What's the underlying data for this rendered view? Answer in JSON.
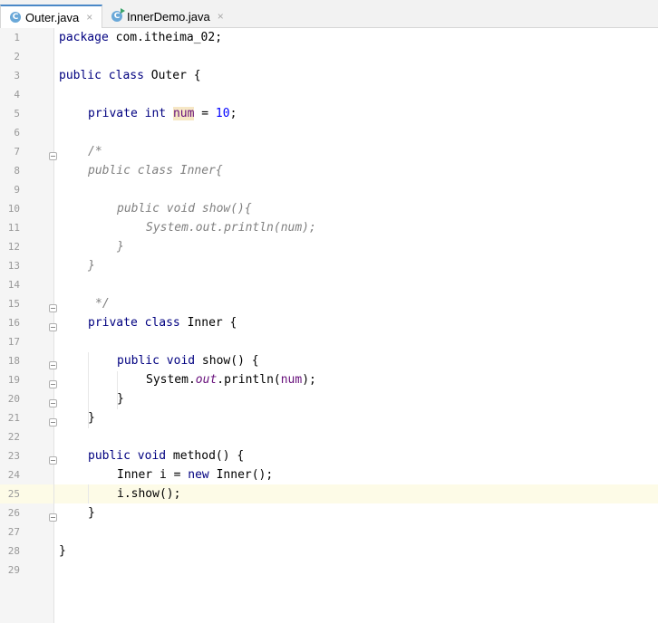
{
  "tabs": [
    {
      "label": "Outer.java",
      "icon": "class-icon",
      "active": true
    },
    {
      "label": "InnerDemo.java",
      "icon": "runnable-class-icon",
      "active": false
    }
  ],
  "close_glyph": "×",
  "class_glyph": "C",
  "line_numbers": [
    "1",
    "2",
    "3",
    "4",
    "5",
    "6",
    "7",
    "8",
    "9",
    "10",
    "11",
    "12",
    "13",
    "14",
    "15",
    "16",
    "17",
    "18",
    "19",
    "20",
    "21",
    "22",
    "23",
    "24",
    "25",
    "26",
    "27",
    "28",
    "29"
  ],
  "code": {
    "l1": {
      "kw": "package",
      "rest": " com.itheima_02;"
    },
    "l3": {
      "kw1": "public",
      "kw2": "class",
      "rest": " Outer {"
    },
    "l5": {
      "kw1": "private",
      "kw2": "int",
      "field": "num",
      "eq": " = ",
      "num": "10",
      "semi": ";"
    },
    "l7": "/*",
    "l8": "public class Inner{",
    "l10": "public void show(){",
    "l11": "System.out.println(num);",
    "l12": "}",
    "l13": "}",
    "l15": "*/",
    "l16": {
      "kw1": "private",
      "kw2": "class",
      "rest": " Inner {"
    },
    "l18": {
      "kw1": "public",
      "kw2": "void",
      "rest": " show() {"
    },
    "l19": {
      "a": "System.",
      "b": "out",
      "c": ".println(",
      "d": "num",
      "e": ");"
    },
    "l20": "}",
    "l21": "}",
    "l23": {
      "kw1": "public",
      "kw2": "void",
      "rest": " method() {"
    },
    "l24": {
      "a": "Inner i = ",
      "kw": "new",
      "b": " Inner();"
    },
    "l25": "i.show();",
    "l26": "}",
    "l28": "}"
  },
  "colors": {
    "keyword": "#000080",
    "number": "#0000ff",
    "comment": "#808080",
    "field": "#660e7a",
    "caret_row": "#fdfbe7",
    "tab_accent": "#4a88c7"
  }
}
